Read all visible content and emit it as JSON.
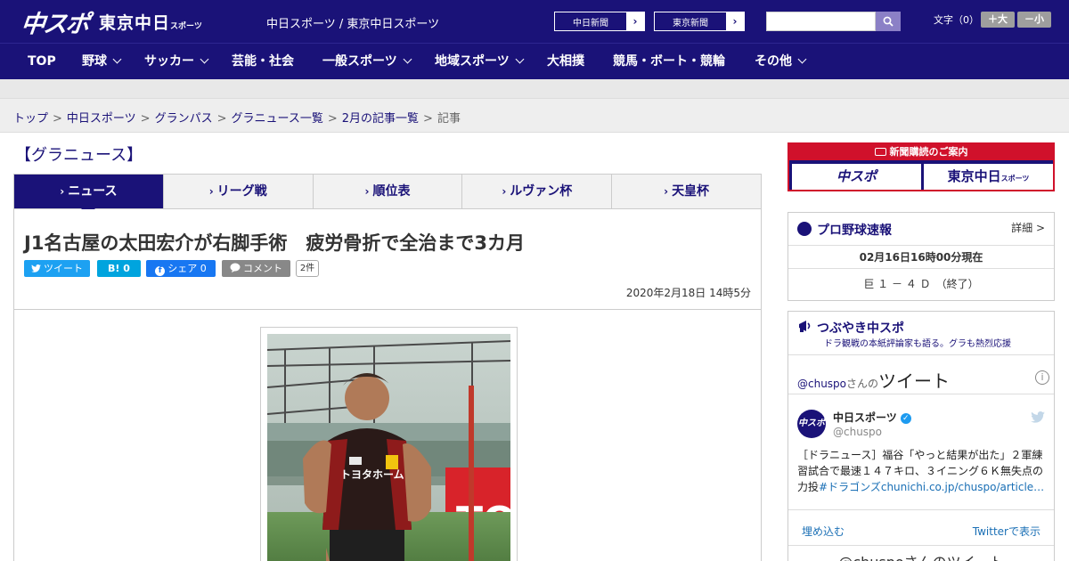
{
  "header": {
    "logo_main": "中スポ",
    "logo_sub": "東京中日",
    "logo_sub_small": "スポーツ",
    "site_name": "中日スポーツ / 東京中日スポーツ",
    "paper_links": [
      "中日新聞",
      "東京新聞"
    ],
    "search": {
      "placeholder": ""
    },
    "font_size_label": "文字（0）",
    "font_plus": "＋大",
    "font_minus": "－小"
  },
  "nav": {
    "items": [
      {
        "label": "TOP",
        "has_dropdown": false
      },
      {
        "label": "野球",
        "has_dropdown": true
      },
      {
        "label": "サッカー",
        "has_dropdown": true
      },
      {
        "label": "芸能・社会",
        "has_dropdown": false
      },
      {
        "label": "一般スポーツ",
        "has_dropdown": true
      },
      {
        "label": "地域スポーツ",
        "has_dropdown": true
      },
      {
        "label": "大相撲",
        "has_dropdown": false
      },
      {
        "label": "競馬・ボート・競輪",
        "has_dropdown": false
      },
      {
        "label": "その他",
        "has_dropdown": true
      }
    ]
  },
  "breadcrumb": {
    "items": [
      "トップ",
      "中日スポーツ",
      "グランパス",
      "グラニュース一覧",
      "2月の記事一覧",
      "記事"
    ]
  },
  "section_title": "【グラニュース】",
  "tabs": [
    "ニュース",
    "リーグ戦",
    "順位表",
    "ルヴァン杯",
    "天皇杯"
  ],
  "article": {
    "headline": "J1名古屋の太田宏介が右脚手術　疲労骨折で全治まで3カ月",
    "share": {
      "tweet": "ツイート",
      "hatena": "B! 0",
      "facebook": "シェア 0",
      "comment": "コメント",
      "comment_count": "2件"
    },
    "date": "2020年2月18日 14時5分",
    "photo": {
      "jersey_text": "トヨタホーム",
      "banner_text": "TO"
    }
  },
  "sidebar": {
    "subscription": {
      "header": "新聞購読のご案内",
      "logos": [
        "中スポ",
        "東京中日"
      ],
      "logo_small": "スポーツ"
    },
    "baseball": {
      "title": "プロ野球速報",
      "detail": "詳細 >",
      "timestamp": "02月16日16時00分現在",
      "score": "巨 １ － ４ Ｄ　（終了）"
    },
    "tsubuyaki": {
      "title": "つぶやき中スポ",
      "subtitle": "ドラ観戦の本紙評論家も語る。グラも熱烈応援",
      "timeline_prefix": "@chuspo",
      "timeline_mid": "さんの",
      "timeline_big": "ツイート",
      "tweet": {
        "avatar_text": "中スポ",
        "name": "中日スポーツ",
        "handle": "@chuspo",
        "text": "［ドラニュース］福谷「やっと結果が出た」２軍練習試合で最速１４７キロ、３イニング６Ｋ無失点の力投",
        "link": "#ドラゴンズ",
        "url": "chunichi.co.jp/chuspo/article…"
      },
      "embed": "埋め込む",
      "view_on_twitter": "Twitterで表示",
      "more": "@chuspoさんのツイート"
    }
  },
  "colors": {
    "brand_navy": "#1a1278",
    "accent_red": "#d0112b",
    "twitter_blue": "#1da1f2",
    "hatena_blue": "#00a4de",
    "facebook_blue": "#1877f2",
    "comment_gray": "#888888"
  }
}
